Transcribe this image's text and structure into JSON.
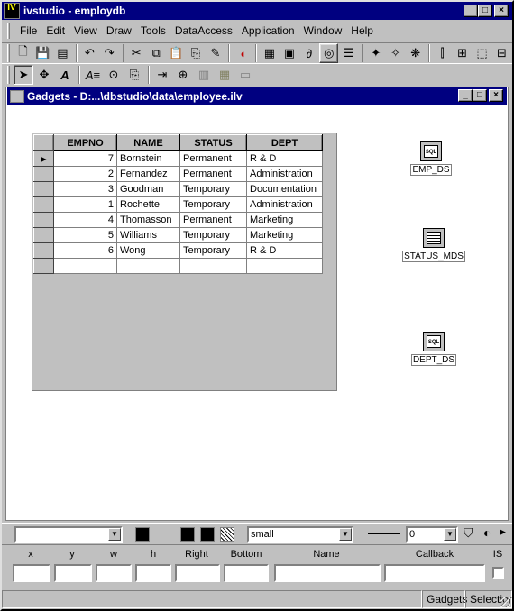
{
  "app": {
    "title": "ivstudio - employdb",
    "logo_text": "IV"
  },
  "menu": [
    "File",
    "Edit",
    "View",
    "Draw",
    "Tools",
    "DataAccess",
    "Application",
    "Window",
    "Help"
  ],
  "child_window": {
    "title": "Gadgets - D:...\\dbstudio\\data\\employee.ilv"
  },
  "grid": {
    "columns": [
      "EMPNO",
      "NAME",
      "STATUS",
      "DEPT"
    ],
    "current_row_marker": "▶",
    "rows": [
      {
        "empno": "7",
        "name": "Bornstein",
        "status": "Permanent",
        "dept": "R & D"
      },
      {
        "empno": "2",
        "name": "Fernandez",
        "status": "Permanent",
        "dept": "Administration"
      },
      {
        "empno": "3",
        "name": "Goodman",
        "status": "Temporary",
        "dept": "Documentation"
      },
      {
        "empno": "1",
        "name": "Rochette",
        "status": "Temporary",
        "dept": "Administration"
      },
      {
        "empno": "4",
        "name": "Thomasson",
        "status": "Permanent",
        "dept": "Marketing"
      },
      {
        "empno": "5",
        "name": "Williams",
        "status": "Temporary",
        "dept": "Marketing"
      },
      {
        "empno": "6",
        "name": "Wong",
        "status": "Temporary",
        "dept": "R & D"
      }
    ]
  },
  "data_sources": [
    {
      "label": "EMP_DS",
      "icon": "sql-icon",
      "icon_text": "SQL"
    },
    {
      "label": "STATUS_MDS",
      "icon": "table-icon",
      "icon_text": ""
    },
    {
      "label": "DEPT_DS",
      "icon": "sql-icon",
      "icon_text": "SQL"
    }
  ],
  "style_bar": {
    "font_combo_value": "",
    "size_combo_value": "small",
    "line_width_value": "0"
  },
  "inspector": {
    "labels": {
      "x": "x",
      "y": "y",
      "w": "w",
      "h": "h",
      "right": "Right",
      "bottom": "Bottom",
      "name": "Name",
      "callback": "Callback",
      "is": "IS"
    },
    "values": {
      "x": "",
      "y": "",
      "w": "",
      "h": "",
      "right": "",
      "bottom": "",
      "name": "",
      "callback": ""
    }
  },
  "status_bar": {
    "panel1": "Gadgets",
    "panel2": "Selection"
  },
  "colors": {
    "title_bar": "#000080",
    "face": "#c0c0c0"
  }
}
